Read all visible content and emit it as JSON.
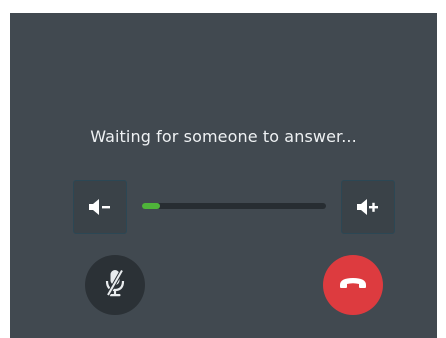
{
  "call": {
    "status": "Waiting for someone to answer...",
    "volume": {
      "level_fraction": 0.1,
      "decrease_icon": "volume-down-icon",
      "increase_icon": "volume-up-icon"
    },
    "controls": {
      "mute_icon": "microphone-muted-icon",
      "hangup_icon": "phone-hangup-icon"
    }
  },
  "colors": {
    "panel_bg": "#414950",
    "text": "#eef1f3",
    "volume_fill": "#4fb43a",
    "hangup": "#dd3b3f",
    "mute_bg": "#2b3136"
  }
}
